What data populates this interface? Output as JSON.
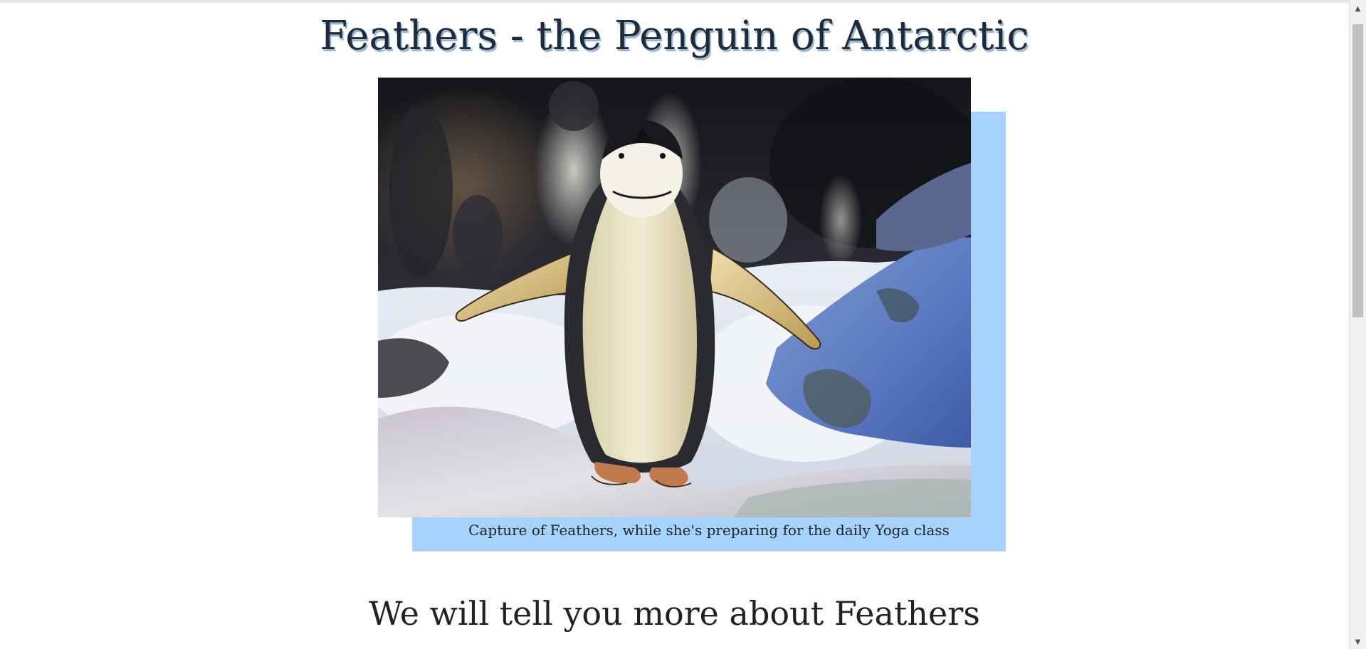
{
  "header": {
    "title": "Feathers - the Penguin of Antarctic"
  },
  "figure": {
    "image_alt": "Penguin Feathers standing on snow with flippers spread",
    "caption": "Capture of Feathers, while she's preparing for the daily Yoga class"
  },
  "main": {
    "section_heading": "We will tell you more about Feathers"
  },
  "colors": {
    "caption_panel": "#a5d3fb",
    "title_shadow": "#8fb3cf",
    "text": "#1f2a3a"
  },
  "scrollbar": {
    "up_icon": "triangle-up-icon",
    "down_icon": "triangle-down-icon",
    "position_fraction": 0.0
  }
}
